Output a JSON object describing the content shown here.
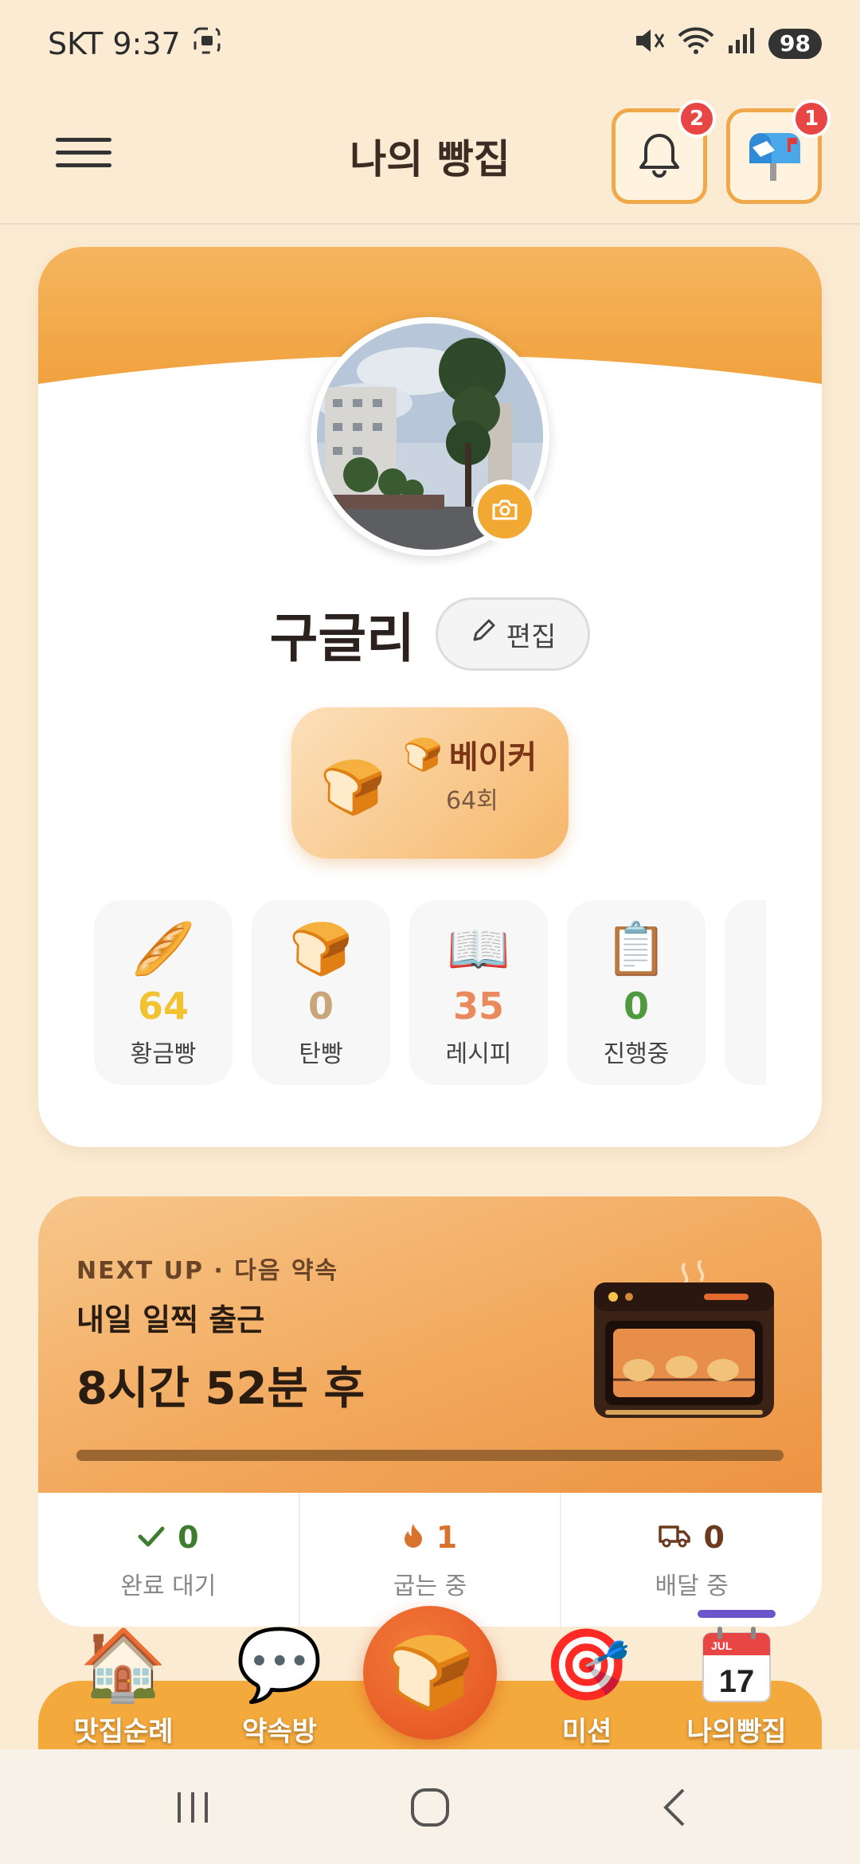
{
  "status_bar": {
    "carrier_time": "SKT 9:37",
    "battery": "98"
  },
  "header": {
    "title": "나의 빵집",
    "bell_badge": "2",
    "mail_badge": "1"
  },
  "profile": {
    "name": "구글리",
    "edit_label": "편집",
    "rank": {
      "title": "베이커",
      "count": "64회"
    },
    "stats": [
      {
        "icon": "baguette-icon",
        "value": "64",
        "label": "황금빵",
        "color": "#f2c230"
      },
      {
        "icon": "bread-icon",
        "value": "0",
        "label": "탄빵",
        "color": "#c9a57a"
      },
      {
        "icon": "recipe-book-icon",
        "value": "35",
        "label": "레시피",
        "color": "#ea8a5c"
      },
      {
        "icon": "clipboard-icon",
        "value": "0",
        "label": "진행중",
        "color": "#4f9a3e"
      }
    ]
  },
  "next_up": {
    "kicker": "NEXT UP · 다음 약속",
    "title": "내일 일찍 출근",
    "time_left": "8시간 52분 후",
    "progress": 1.0,
    "order_stats": [
      {
        "icon": "check-icon",
        "value": "0",
        "label": "완료 대기",
        "color": "#3f7d2e"
      },
      {
        "icon": "flame-icon",
        "value": "1",
        "label": "굽는 중",
        "color": "#d8722c"
      },
      {
        "icon": "truck-icon",
        "value": "0",
        "label": "배달 중",
        "color": "#6b3a1f"
      }
    ]
  },
  "bottom_nav": [
    {
      "icon": "house-icon",
      "label": "맛집순례"
    },
    {
      "icon": "speech-bubble-icon",
      "label": "약속방"
    },
    {
      "icon": "target-icon",
      "label": "미션"
    },
    {
      "icon": "calendar-icon",
      "label": "나의빵집",
      "calendar_month": "JUL",
      "calendar_day": "17"
    }
  ],
  "colors": {
    "accent": "#f4a93c",
    "background": "#fbebd3",
    "badge": "#e84545"
  }
}
